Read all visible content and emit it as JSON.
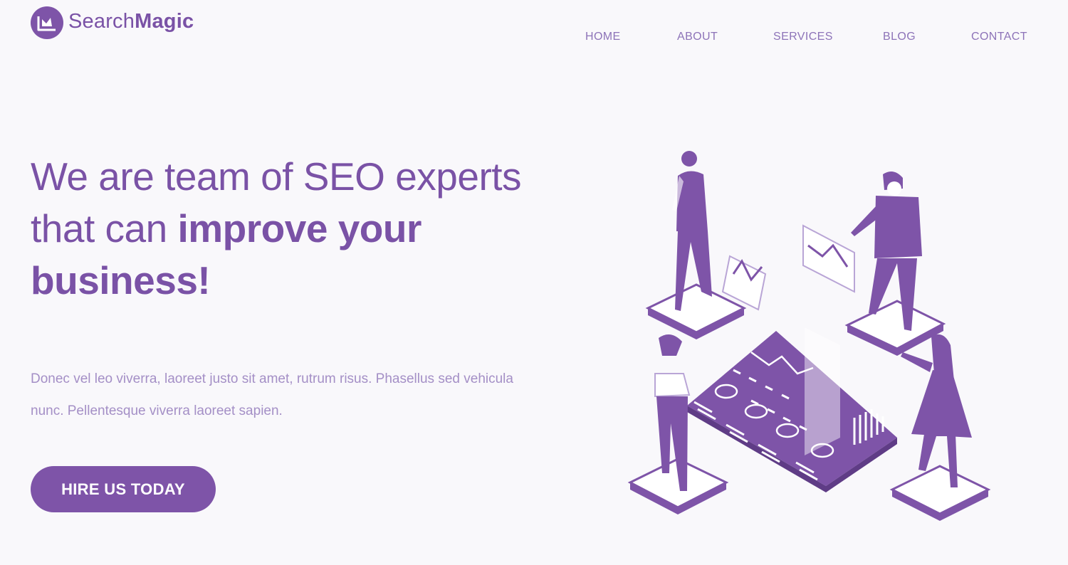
{
  "brand": {
    "name_light": "Search",
    "name_bold": "Magic",
    "logo_icon": "chart-window-icon"
  },
  "nav": {
    "items": [
      {
        "label": "HOME"
      },
      {
        "label": "ABOUT"
      },
      {
        "label": "SERVICES"
      },
      {
        "label": "BLOG"
      },
      {
        "label": "CONTACT"
      }
    ]
  },
  "hero": {
    "headline_line1": "We are team of SEO experts",
    "headline_line2_plain": "that can ",
    "headline_line2_bold": "improve your",
    "headline_line3_bold": "business!",
    "description": "Donec vel leo viverra, laoreet justo sit amet, rutrum risus. Phasellus sed vehicula nunc. Pellentesque viverra laoreet sapien.",
    "cta_label": "HIRE US TODAY",
    "illustration": "isometric-seo-team-illustration"
  },
  "colors": {
    "background": "#f9f8fb",
    "brand_purple": "#7e54a8",
    "text_purple": "#7a52a6",
    "muted_purple": "#a48fc6",
    "nav_purple": "#8d73b8"
  }
}
